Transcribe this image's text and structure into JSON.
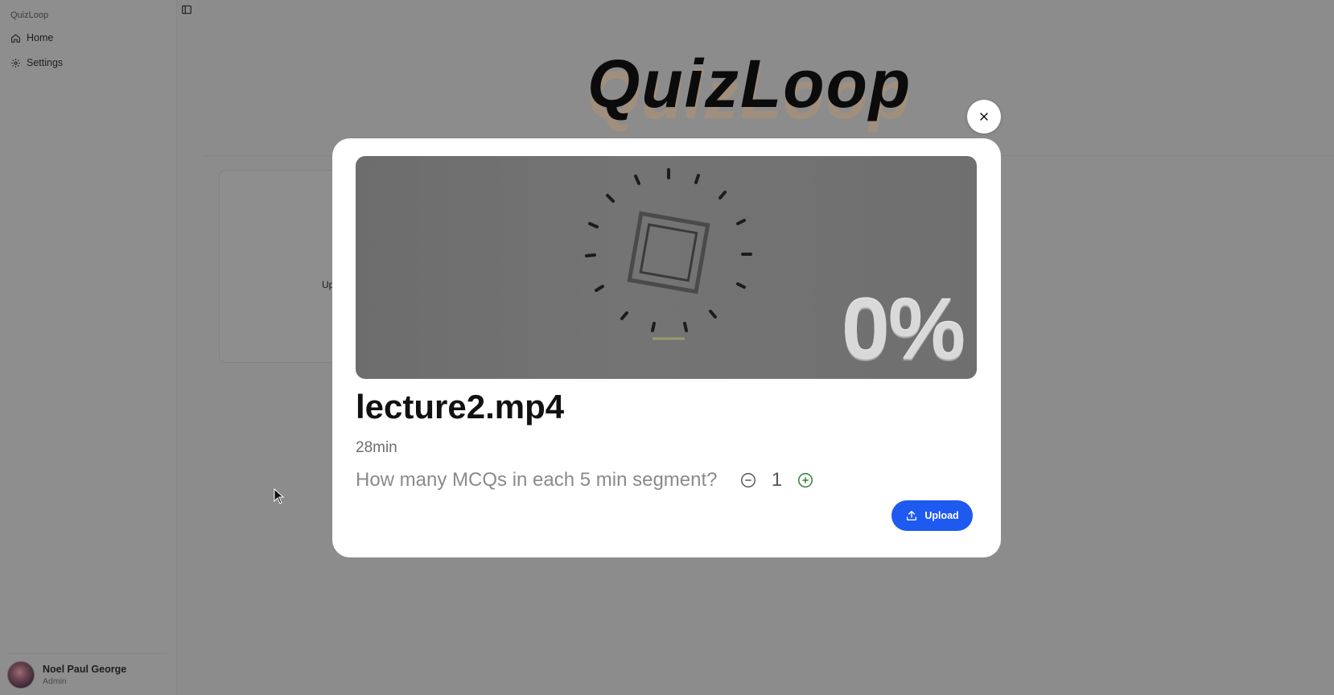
{
  "sidebar": {
    "brand": "QuizLoop",
    "items": [
      {
        "label": "Home",
        "icon": "home-icon"
      },
      {
        "label": "Settings",
        "icon": "gear-icon"
      }
    ],
    "user": {
      "name": "Noel Paul George",
      "role": "Admin"
    }
  },
  "main": {
    "hero_title": "QuizLoop",
    "upload_card_label": "Up"
  },
  "modal": {
    "progress": {
      "value": "0%",
      "fraction": 0
    },
    "file_name": "lecture2.mp4",
    "duration": "28min",
    "mcq": {
      "question": "How many MCQs in each 5 min segment?",
      "count": "1"
    },
    "upload_label": "Upload"
  },
  "colors": {
    "accent": "#1e5af0",
    "plus_icon": "#2e7d32",
    "overlay": "#8c8c8c",
    "modal_bg": "#ffffff"
  }
}
